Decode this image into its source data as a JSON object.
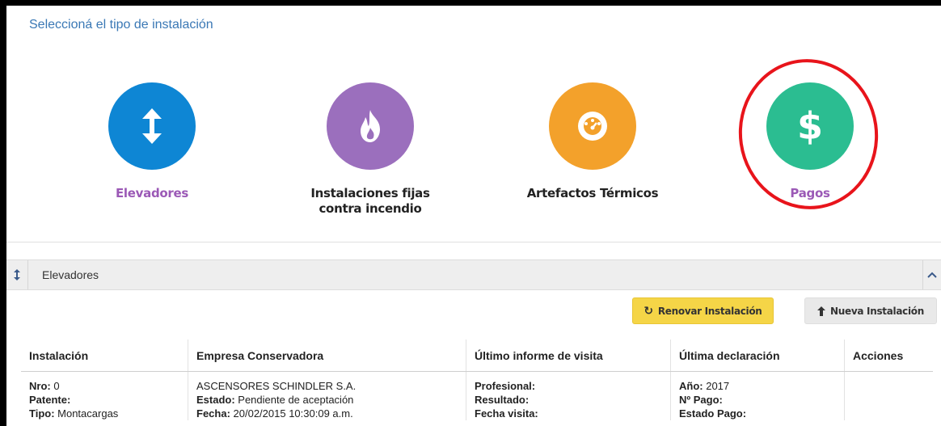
{
  "header": {
    "title": "Seleccioná el tipo de instalación"
  },
  "tiles": [
    {
      "label": "Elevadores",
      "icon": "up-down-arrow-icon",
      "color": "#0e86d4",
      "label_color": "#9b59b6"
    },
    {
      "label": "Instalaciones fijas contra incendio",
      "icon": "fire-icon",
      "color": "#9b6fbd",
      "label_color": "#222222"
    },
    {
      "label": "Artefactos Térmicos",
      "icon": "gauge-icon",
      "color": "#f3a12b",
      "label_color": "#222222"
    },
    {
      "label": "Pagos",
      "icon": "dollar-icon",
      "color": "#2bbd91",
      "label_color": "#9b59b6"
    }
  ],
  "panel": {
    "title": "Elevadores"
  },
  "actions": {
    "renew_label": "Renovar Instalación",
    "new_label": "Nueva Instalación"
  },
  "table": {
    "columns": [
      "Instalación",
      "Empresa Conservadora",
      "Último informe de visita",
      "Última declaración",
      "Acciones"
    ],
    "row": {
      "nro_label": "Nro:",
      "nro_value": " 0",
      "patente_label": "Patente:",
      "patente_value": "",
      "tipo_label": "Tipo:",
      "tipo_value": " Montacargas",
      "empresa": "ASCENSORES SCHINDLER S.A.",
      "estado_label": "Estado:",
      "estado_value": " Pendiente de aceptación",
      "fecha_label": "Fecha:",
      "fecha_value": " 20/02/2015 10:30:09 a.m.",
      "profesional_label": "Profesional:",
      "resultado_label": "Resultado:",
      "fecha_visita_label": "Fecha visita:",
      "anio_label": "Año:",
      "anio_value": " 2017",
      "npago_label": "Nº Pago:",
      "estado_pago_label": "Estado Pago:"
    }
  },
  "colors": {
    "title_blue": "#3a78b5",
    "highlight_red": "#e8141b",
    "button_yellow": "#f5d547"
  }
}
